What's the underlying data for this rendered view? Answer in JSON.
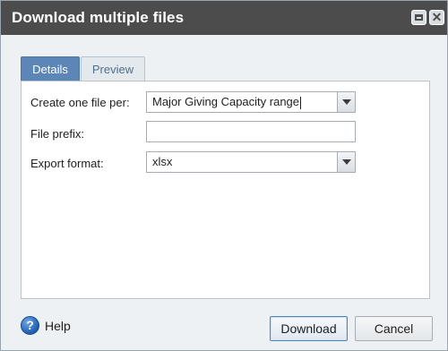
{
  "dialog": {
    "title": "Download multiple files"
  },
  "tabs": [
    {
      "label": "Details",
      "active": true
    },
    {
      "label": "Preview",
      "active": false
    }
  ],
  "form": {
    "create_one_file_per": {
      "label": "Create one file per:",
      "value": "Major Giving Capacity range"
    },
    "file_prefix": {
      "label": "File prefix:",
      "value": ""
    },
    "export_format": {
      "label": "Export format:",
      "value": "xlsx"
    }
  },
  "footer": {
    "help_label": "Help",
    "download_label": "Download",
    "cancel_label": "Cancel"
  },
  "icons": {
    "restore": "restore-icon",
    "close": "close-icon",
    "help": "help-icon",
    "dropdown": "chevron-down-icon"
  },
  "colors": {
    "titlebar": "#4c4c4c",
    "active_tab": "#5b86b5",
    "primary_button_border": "#4f86c2"
  }
}
